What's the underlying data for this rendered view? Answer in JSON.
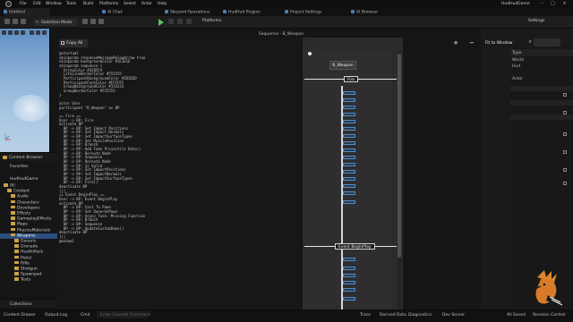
{
  "app": {
    "project": "HudHudGame"
  },
  "menu": [
    "File",
    "Edit",
    "Window",
    "Tools",
    "Build",
    "Platforms",
    "Select",
    "Actor",
    "Help"
  ],
  "tabs": [
    {
      "label": "Untitled"
    },
    {
      "label": "AI Chat"
    },
    {
      "label": "Skeyord Operations"
    },
    {
      "label": "HudHud Plugins"
    },
    {
      "label": "Project Settings"
    },
    {
      "label": "AI Browser"
    }
  ],
  "toolbar": {
    "selection_mode": "Selection Mode",
    "platforms": "Platforms",
    "settings": "Settings"
  },
  "content_browser": {
    "title": "Content Browser",
    "favorites": "Favorites",
    "project": "HudHudGame",
    "tree": [
      {
        "label": "All",
        "depth": 0
      },
      {
        "label": "Content",
        "depth": 1
      },
      {
        "label": "Audio",
        "depth": 2
      },
      {
        "label": "Characters",
        "depth": 2
      },
      {
        "label": "Developers",
        "depth": 2
      },
      {
        "label": "Effects",
        "depth": 2
      },
      {
        "label": "GameplayEffects",
        "depth": 2
      },
      {
        "label": "Maps",
        "depth": 2
      },
      {
        "label": "PhysicsMaterials",
        "depth": 2
      },
      {
        "label": "Weapons",
        "depth": 2,
        "selected": true
      },
      {
        "label": "Generic",
        "depth": 3
      },
      {
        "label": "Grenade",
        "depth": 3
      },
      {
        "label": "HealthPack",
        "depth": 3
      },
      {
        "label": "Pistol",
        "depth": 3
      },
      {
        "label": "Rifle",
        "depth": 3
      },
      {
        "label": "Shotgun",
        "depth": 3
      },
      {
        "label": "Spawnpad",
        "depth": 3
      },
      {
        "label": "Tests",
        "depth": 3
      }
    ],
    "collections": "Collections"
  },
  "text_panel": {
    "copy_all": "Copy All",
    "code": "@startuml\nskinparam responseMessageBelowArrow true\nskinparam backgroundColor #1E1E1E\nskinparam sequence {\n  ArrowColor #4285F4\n  LifeLineBorderColor #555555\n  ParticipantBackgroundColor #2D2D2D\n  ParticipantFontColor #FFFFFF\n  GroupBackgroundColor #333333\n  GroupBorderColor #555555\n}\n\nactor User\nparticipant \"B_Weapon\" as BP\n\n== Fire ==\nUser -> BP: Fire\nactivate BP\n  BP -> BP: Set Impact Positions\n  BP -> BP: Set Impact Normals\n  BP -> BP: Set ImpactSurfaceTypes\n  BP -> BP: Set MuzzlePosition\n  BP -> BP: Branch\n  BP -> BP: Add Fake Projectile Data()\n  BP -> BP: Reroute Node\n  BP -> BP: Sequence\n  BP -> BP: Reroute Node\n  BP -> BP: Is Valid\n  BP -> BP: Set ImpactPositions\n  BP -> BP: Set ImpactNormals\n  BP -> BP: Set ImpactSurfaceTypes\n  BP -> BP: Fire()\ndeactivate BP\n|||\n== Event BeginPlay ==\nUser -> BP: Event BeginPlay\nactivate BP\n  BP -> BP: Cast To Pawn\n  BP -> BP: Set OwnerAsPawn\n  BP -> BP: Async Task: Missing Function\n  BP -> BP: Branch\n  BP -> BP: Sequence\n  BP -> BP: UpdateCustomDemo()\ndeactivate BP\n|||\n@enduml"
  },
  "sequence": {
    "title": "Sequence - B_Weapon",
    "participant": "B_Weapon",
    "sections": [
      "Fire",
      "Event BeginPlay"
    ]
  },
  "right_panel": {
    "fit_button": "Fit to Window",
    "details": [
      "Type",
      "World",
      "Hud",
      "Actor"
    ]
  },
  "statusbar": {
    "content_drawer": "Content Drawer",
    "output_log": "Output Log",
    "cmd": "Cmd",
    "cmd_placeholder": "Enter Console Command",
    "trace": "Trace",
    "derived_data": "Derived Data",
    "diagnostics": "Diagnostics",
    "dev_server": "Dev Server",
    "all_saved": "All Saved",
    "revision_control": "Revision Control"
  },
  "colors": {
    "accent": "#4a8fd6",
    "selection": "#2a4f7e",
    "folder": "#c9a14a",
    "play": "#5cc05c"
  }
}
